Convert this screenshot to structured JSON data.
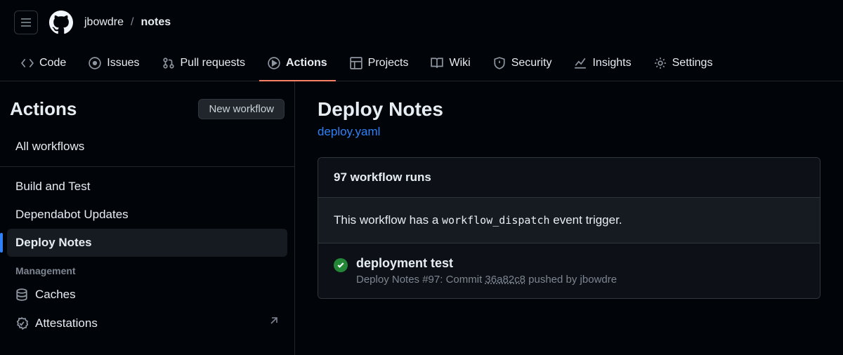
{
  "breadcrumb": {
    "owner": "jbowdre",
    "sep": "/",
    "repo": "notes"
  },
  "tabs": {
    "code": "Code",
    "issues": "Issues",
    "pulls": "Pull requests",
    "actions": "Actions",
    "projects": "Projects",
    "wiki": "Wiki",
    "security": "Security",
    "insights": "Insights",
    "settings": "Settings"
  },
  "sidebar": {
    "title": "Actions",
    "new_workflow": "New workflow",
    "all": "All workflows",
    "workflows": [
      "Build and Test",
      "Dependabot Updates",
      "Deploy Notes"
    ],
    "management_heading": "Management",
    "management": [
      "Caches",
      "Attestations"
    ]
  },
  "content": {
    "title": "Deploy Notes",
    "file": "deploy.yaml",
    "runs_count": "97 workflow runs",
    "info_prefix": "This workflow has a ",
    "info_code": "workflow_dispatch",
    "info_suffix": " event trigger.",
    "run": {
      "title": "deployment test",
      "workflow": "Deploy Notes",
      "num": "#97",
      "action_prefix": ": Commit ",
      "sha": "36a82c8",
      "action_mid": " pushed by ",
      "actor": "jbowdre"
    }
  }
}
